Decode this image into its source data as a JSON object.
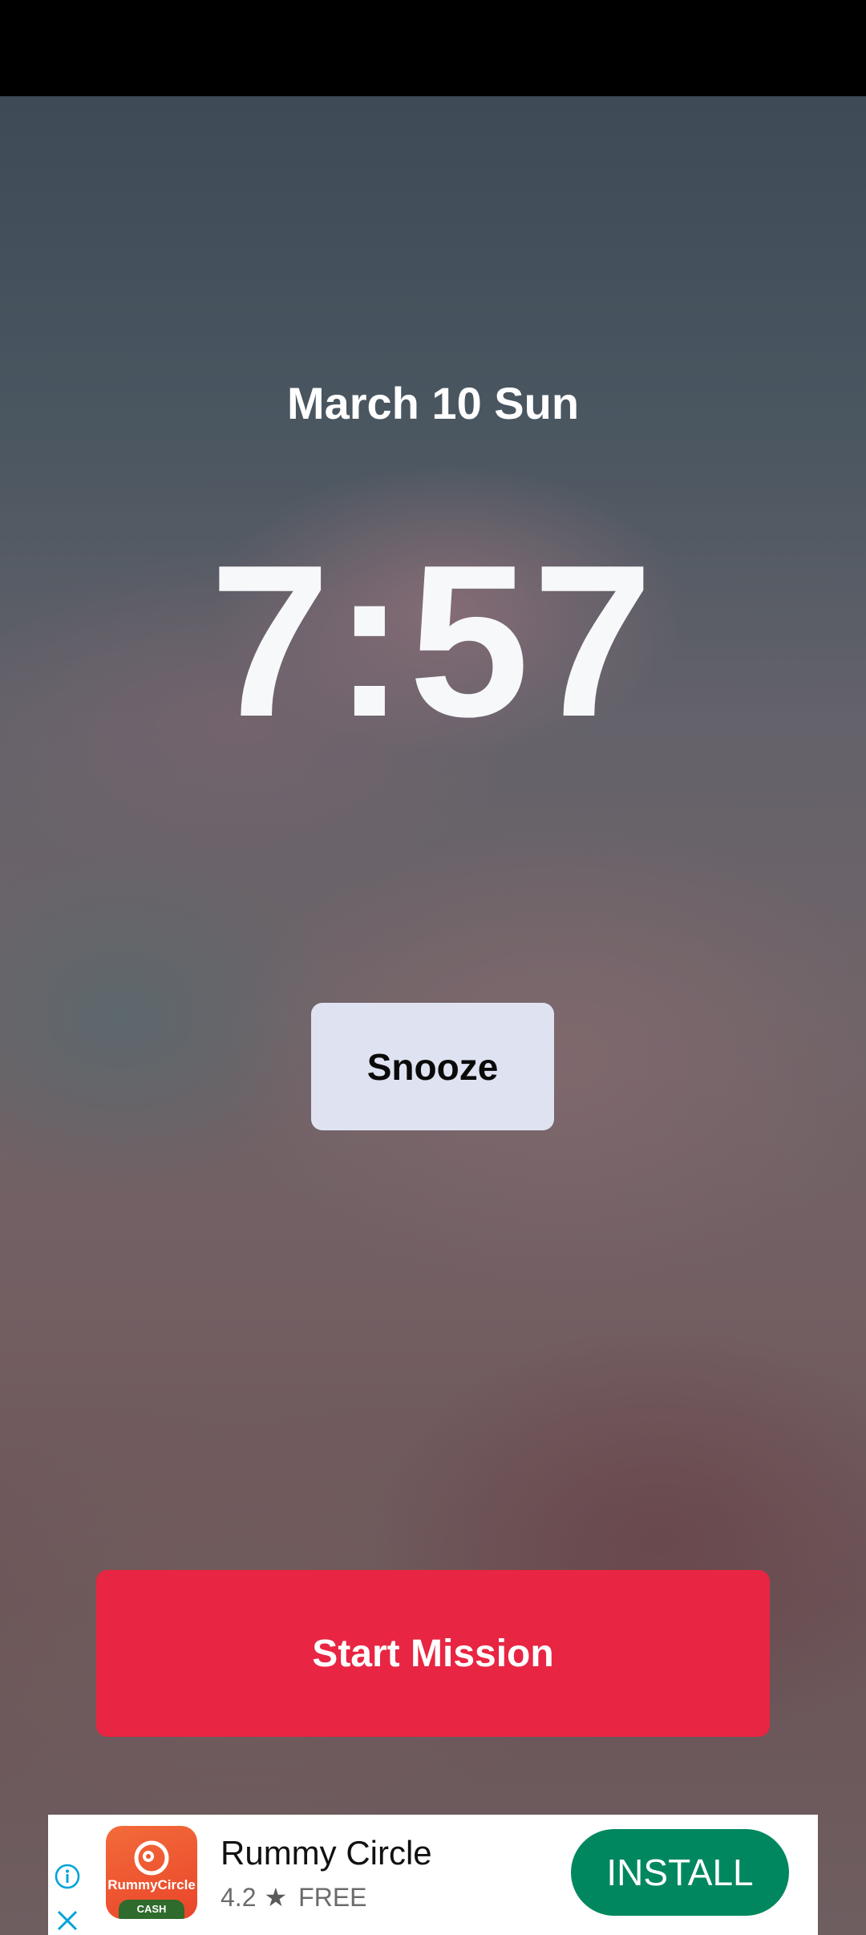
{
  "alarm": {
    "date": "March 10 Sun",
    "time": "7:57",
    "snooze_label": "Snooze",
    "start_mission_label": "Start Mission"
  },
  "ad": {
    "app_name": "Rummy Circle",
    "rating": "4.2",
    "price": "FREE",
    "install_label": "INSTALL",
    "icon_brand_text": "RummyCircle",
    "icon_cash_text": "CASH",
    "info_icon": "info-icon",
    "close_icon": "close-icon",
    "star_icon": "star-icon"
  },
  "colors": {
    "start_mission": "#e82542",
    "snooze": "#dfe3f1",
    "install": "#01875f",
    "ad_info_accent": "#00a3d9"
  }
}
